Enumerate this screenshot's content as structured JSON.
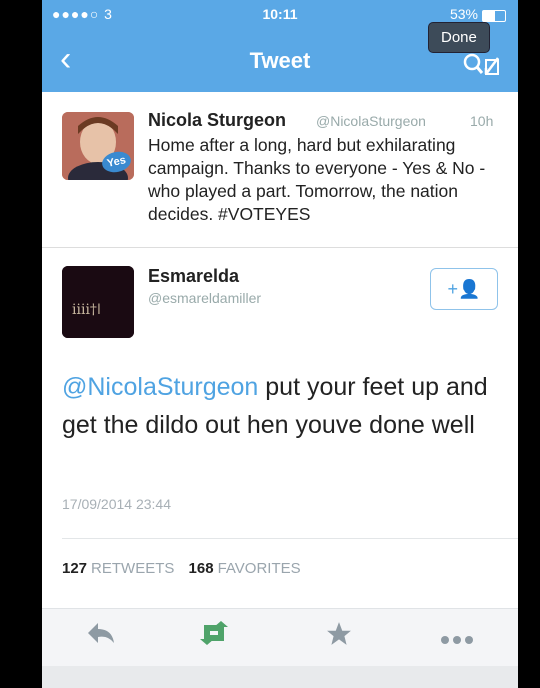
{
  "status_bar": {
    "carrier": "●●●●○ 3",
    "time": "10:11",
    "battery": "53%"
  },
  "nav": {
    "title": "Tweet",
    "done_label": "Done"
  },
  "quoted_tweet": {
    "name": "Nicola Sturgeon",
    "handle": "@NicolaSturgeon",
    "time": "10h",
    "text": "Home after a long, hard but exhilarating campaign. Thanks to everyone - Yes & No - who played a part. Tomorrow, the nation decides. #VOTEYES",
    "avatar_badge": "Yes"
  },
  "reply_tweet": {
    "name": "Esmarelda",
    "handle": "@esmareldamiller",
    "mention": "@NicolaSturgeon",
    "text": " put your feet up and get the dildo out hen youve done well",
    "date": "17/09/2014 23:44",
    "retweets_count": "127",
    "retweets_label": "RETWEETS",
    "favorites_count": "168",
    "favorites_label": "FAVORITES"
  },
  "actions": [
    "reply-icon",
    "retweet-icon",
    "favorite-icon",
    "more-icon"
  ],
  "colors": {
    "nav_blue": "#5aa8e6",
    "link_blue": "#4fa3e2",
    "retweet_green": "#4fa36a"
  }
}
